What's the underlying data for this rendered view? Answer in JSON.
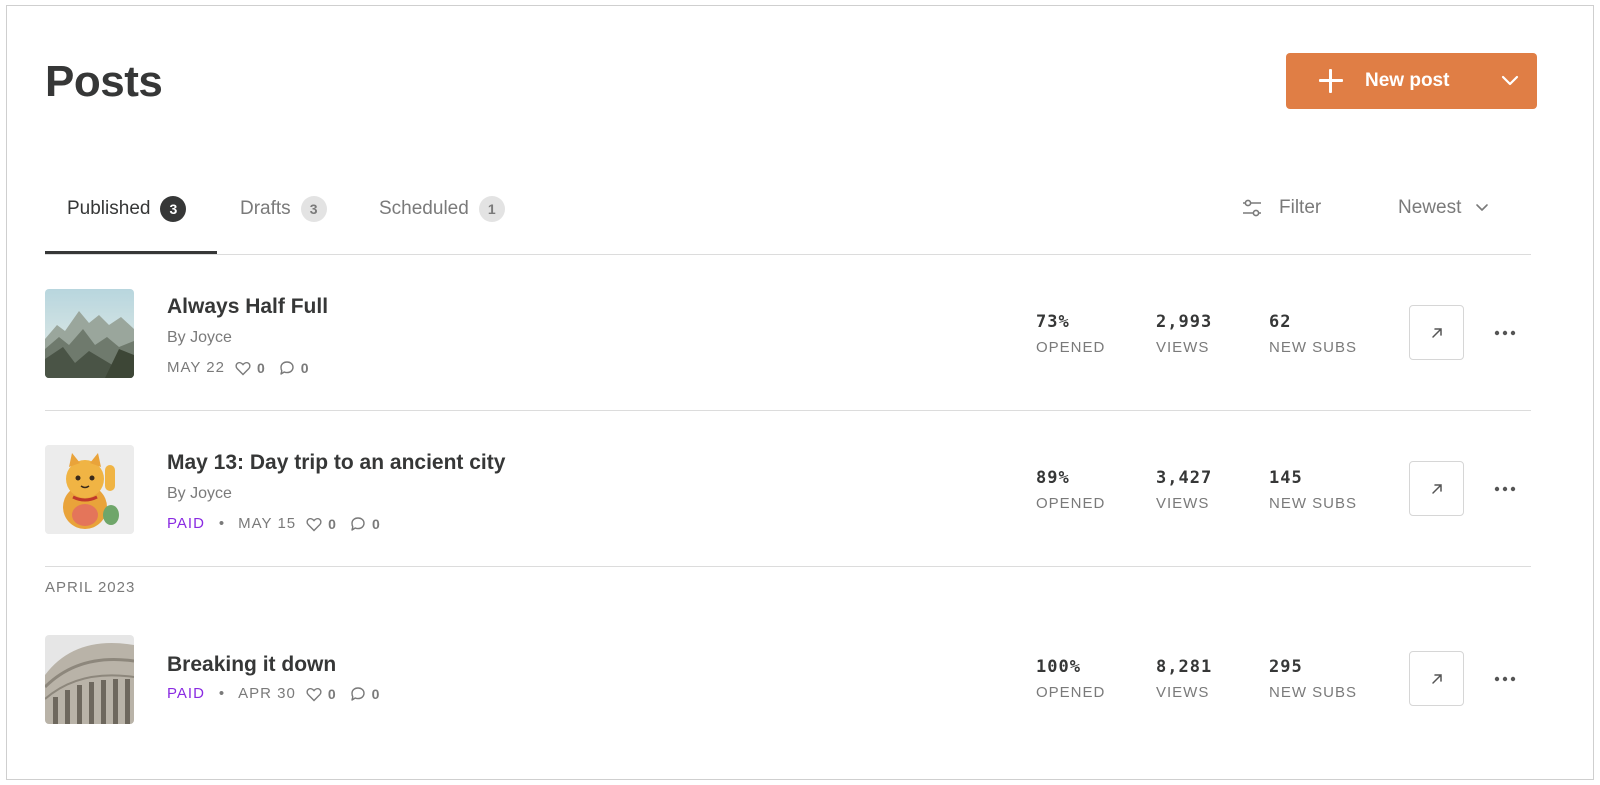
{
  "page": {
    "title": "Posts"
  },
  "new_post": {
    "label": "New post",
    "icon": "plus-icon",
    "menu_icon": "chevron-down-icon",
    "color": "#e07e45"
  },
  "tabs": [
    {
      "label": "Published",
      "count": "3",
      "active": true
    },
    {
      "label": "Drafts",
      "count": "3",
      "active": false
    },
    {
      "label": "Scheduled",
      "count": "1",
      "active": false
    }
  ],
  "filter": {
    "label": "Filter",
    "icon": "sliders-icon"
  },
  "sort": {
    "label": "Newest",
    "icon": "chevron-down-icon"
  },
  "stat_labels": {
    "opened": "OPENED",
    "views": "VIEWS",
    "subs": "NEW SUBS"
  },
  "posts": [
    {
      "title": "Always Half Full",
      "author": "By Joyce",
      "paid": "",
      "date": "MAY 22",
      "likes": "0",
      "comments": "0",
      "opened": "73%",
      "views": "2,993",
      "subs": "62",
      "thumbnail": "mountain-landscape"
    },
    {
      "title": "May 13: Day trip to an ancient city",
      "author": "By Joyce",
      "paid": "PAID",
      "date": "MAY 15",
      "likes": "0",
      "comments": "0",
      "opened": "89%",
      "views": "3,427",
      "subs": "145",
      "thumbnail": "lucky-cat-figurine"
    },
    {
      "title": "Breaking it down",
      "author": "",
      "paid": "PAID",
      "date": "APR 30",
      "likes": "0",
      "comments": "0",
      "opened": "100%",
      "views": "8,281",
      "subs": "295",
      "thumbnail": "capitol-dome"
    }
  ],
  "sections": {
    "april": "APRIL 2023"
  },
  "colors": {
    "text": "#363737",
    "muted": "#7a7a7a",
    "paid": "#8a2be2",
    "accent": "#e07e45"
  }
}
